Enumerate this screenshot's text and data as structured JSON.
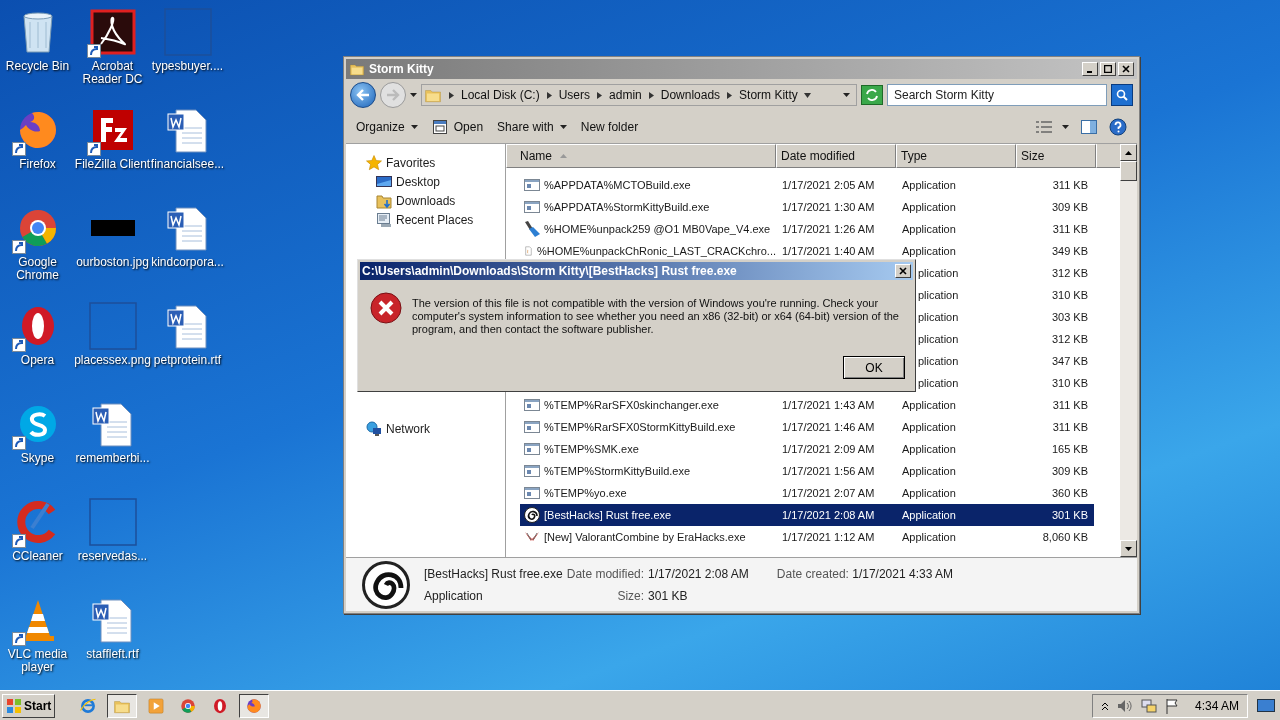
{
  "desktop": {
    "icons": [
      {
        "label": "Recycle Bin",
        "kind": "recycle",
        "shortcut": false
      },
      {
        "label": "Firefox",
        "kind": "firefox",
        "shortcut": true
      },
      {
        "label": "Google Chrome",
        "kind": "chrome",
        "shortcut": true
      },
      {
        "label": "Opera",
        "kind": "opera",
        "shortcut": true
      },
      {
        "label": "Skype",
        "kind": "skype",
        "shortcut": true
      },
      {
        "label": "CCleaner",
        "kind": "ccleaner",
        "shortcut": true
      },
      {
        "label": "VLC media player",
        "kind": "vlc",
        "shortcut": true
      },
      {
        "label": "Acrobat Reader DC",
        "kind": "acrobat",
        "shortcut": true
      },
      {
        "label": "FileZilla Client",
        "kind": "filezilla",
        "shortcut": true
      },
      {
        "label": "ourboston.jpg",
        "kind": "image",
        "shortcut": false
      },
      {
        "label": "placessex.png",
        "kind": "blank",
        "shortcut": false
      },
      {
        "label": "rememberbi...",
        "kind": "word",
        "shortcut": false
      },
      {
        "label": "reservedas...",
        "kind": "blank",
        "shortcut": false
      },
      {
        "label": "staffleft.rtf",
        "kind": "word",
        "shortcut": false
      },
      {
        "label": "typesbuyer....",
        "kind": "blank",
        "shortcut": false
      },
      {
        "label": "financialsee...",
        "kind": "word",
        "shortcut": false
      },
      {
        "label": "kindcorpora...",
        "kind": "word",
        "shortcut": false
      },
      {
        "label": "petprotein.rtf",
        "kind": "word",
        "shortcut": false
      }
    ]
  },
  "explorer": {
    "title": "Storm Kitty",
    "breadcrumb": [
      "Local Disk (C:)",
      "Users",
      "admin",
      "Downloads",
      "Storm Kitty"
    ],
    "search": {
      "placeholder": "Search Storm Kitty"
    },
    "toolbar": [
      {
        "label": "Organize",
        "kind": "menu"
      },
      {
        "label": "Open",
        "kind": "open"
      },
      {
        "label": "Share with",
        "kind": "menu"
      },
      {
        "label": "New folder",
        "kind": "plain"
      }
    ],
    "nav": [
      {
        "label": "Favorites",
        "kind": "star",
        "selected": false,
        "children": [
          {
            "label": "Desktop",
            "kind": "desktop",
            "selected": false
          },
          {
            "label": "Downloads",
            "kind": "downloads",
            "selected": false
          },
          {
            "label": "Recent Places",
            "kind": "recent",
            "selected": false
          }
        ]
      },
      {
        "label": "Network",
        "kind": "network",
        "selected": false
      }
    ],
    "columns": [
      "Name",
      "Date modified",
      "Type",
      "Size"
    ],
    "rows": [
      {
        "name": "%APPDATA%MCTOBuild.exe",
        "date": "1/17/2021 2:05 AM",
        "type": "Application",
        "size": "311 KB",
        "kind": "exe",
        "selected": false
      },
      {
        "name": "%APPDATA%StormKittyBuild.exe",
        "date": "1/17/2021 1:30 AM",
        "type": "Application",
        "size": "309 KB",
        "kind": "exe",
        "selected": false
      },
      {
        "name": "%HOME%unpack259 @O1 MB0Vape_V4.exe",
        "date": "1/17/2021 1:26 AM",
        "type": "Application",
        "size": "311 KB",
        "kind": "brush",
        "selected": false
      },
      {
        "name": "%HOME%unpackChRonic_LAST_CRACKchro...",
        "date": "1/17/2021 1:40 AM",
        "type": "Application",
        "size": "349 KB",
        "kind": "file",
        "selected": false
      },
      {
        "type": "plication",
        "size": "312 KB",
        "selected": false
      },
      {
        "type": "plication",
        "size": "310 KB",
        "selected": false
      },
      {
        "type": "plication",
        "size": "303 KB",
        "selected": false
      },
      {
        "type": "plication",
        "size": "312 KB",
        "selected": false
      },
      {
        "type": "plication",
        "size": "347 KB",
        "selected": false
      },
      {
        "type": "plication",
        "size": "310 KB",
        "selected": false
      },
      {
        "name": "%TEMP%RarSFX0skinchanger.exe",
        "date": "1/17/2021 1:43 AM",
        "type": "Application",
        "size": "311 KB",
        "kind": "exe",
        "selected": false
      },
      {
        "name": "%TEMP%RarSFX0StormKittyBuild.exe",
        "date": "1/17/2021 1:46 AM",
        "type": "Application",
        "size": "311 KB",
        "kind": "exe",
        "selected": false
      },
      {
        "name": "%TEMP%SMK.exe",
        "date": "1/17/2021 2:09 AM",
        "type": "Application",
        "size": "165 KB",
        "kind": "exe",
        "selected": false
      },
      {
        "name": "%TEMP%StormKittyBuild.exe",
        "date": "1/17/2021 1:56 AM",
        "type": "Application",
        "size": "309 KB",
        "kind": "exe",
        "selected": false
      },
      {
        "name": "%TEMP%yo.exe",
        "date": "1/17/2021 2:07 AM",
        "type": "Application",
        "size": "360 KB",
        "kind": "exe",
        "selected": false
      },
      {
        "name": "[BestHacks] Rust free.exe",
        "date": "1/17/2021 2:08 AM",
        "type": "Application",
        "size": "301 KB",
        "kind": "spiral",
        "selected": true
      },
      {
        "name": "[New] ValorantCombine by EraHacks.exe",
        "date": "1/17/2021 1:12 AM",
        "type": "Application",
        "size": "8,060 KB",
        "kind": "wings",
        "selected": false
      }
    ],
    "details": {
      "name": "[BestHacks] Rust free.exe",
      "type": "Application",
      "fields": [
        {
          "label": "Date modified:",
          "value": "1/17/2021 2:08 AM"
        },
        {
          "label": "Size:",
          "value": "301 KB"
        },
        {
          "label": "Date created:",
          "value": "1/17/2021 4:33 AM"
        }
      ]
    }
  },
  "dialog": {
    "title": "C:\\Users\\admin\\Downloads\\Storm Kitty\\[BestHacks] Rust free.exe",
    "message": "The version of this file is not compatible with the version of Windows you're running. Check your computer's system information to see whether you need an x86 (32-bit) or x64 (64-bit) version of the program, and then contact the software publisher.",
    "button": "OK"
  },
  "taskbar": {
    "start": "Start",
    "apps": [
      {
        "kind": "ie",
        "open": false
      },
      {
        "kind": "folder",
        "open": true
      },
      {
        "kind": "media",
        "open": false
      },
      {
        "kind": "chrome",
        "open": false
      },
      {
        "kind": "opera",
        "open": false
      },
      {
        "kind": "firefox",
        "open": true
      }
    ],
    "clock": "4:34 AM"
  }
}
